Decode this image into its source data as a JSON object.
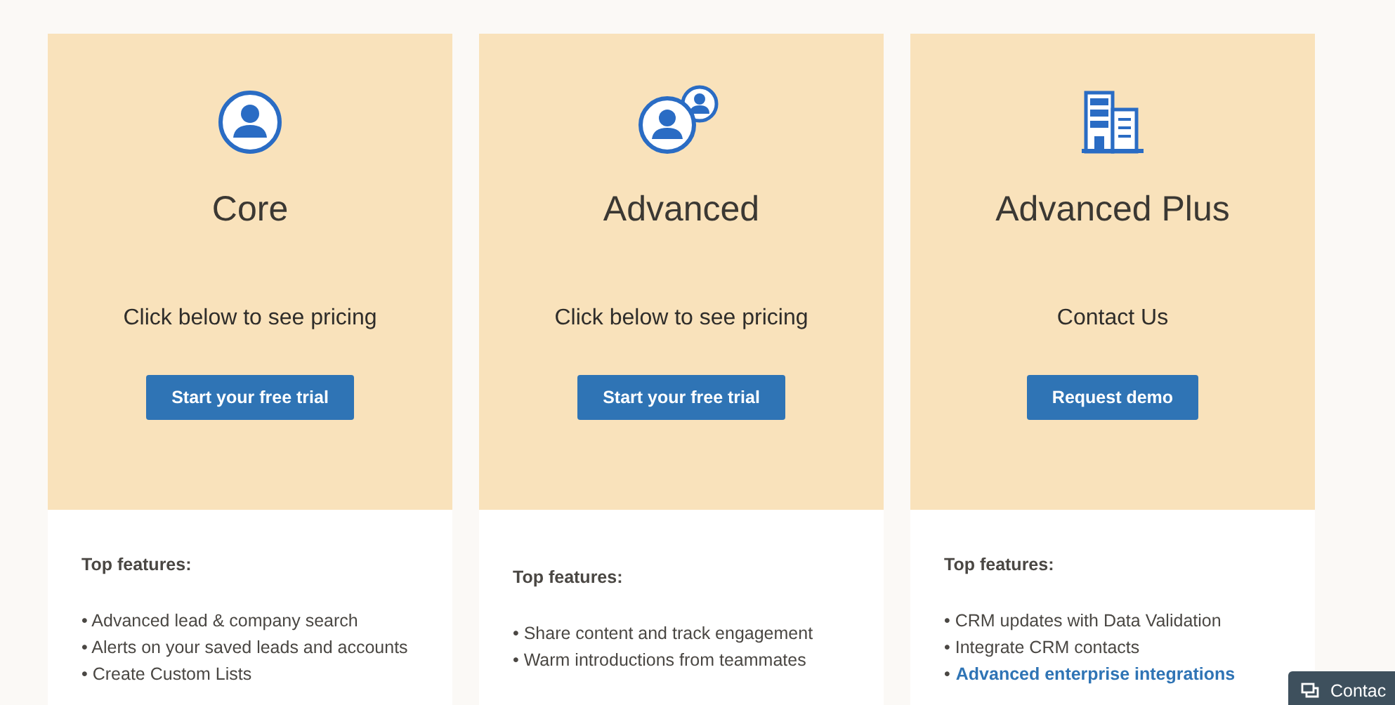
{
  "plans": [
    {
      "kind": "person",
      "name": "Core",
      "description": "Click below to see pricing",
      "button": "Start your free trial",
      "features_heading": "Top features:",
      "features": [
        {
          "kind": "text",
          "text": "• Advanced lead & company search"
        },
        {
          "kind": "text",
          "text": "• Alerts on your saved leads and accounts"
        },
        {
          "kind": "text",
          "text": "• Create Custom Lists"
        }
      ]
    },
    {
      "kind": "people",
      "name": "Advanced",
      "description": "Click below to see pricing",
      "button": "Start your free trial",
      "features_heading": "Top features:",
      "features": [
        {
          "kind": "text",
          "text": "• Share content and track engagement"
        },
        {
          "kind": "text",
          "text": "• Warm introductions from teammates"
        }
      ]
    },
    {
      "kind": "building",
      "name": "Advanced Plus",
      "description": "Contact Us",
      "button": "Request demo",
      "features_heading": "Top features:",
      "features": [
        {
          "kind": "text",
          "text": "• CRM updates with Data Validation"
        },
        {
          "kind": "text",
          "text": "• Integrate CRM contacts"
        },
        {
          "kind": "link",
          "bullet": "•",
          "text": "Advanced enterprise integrations"
        }
      ]
    }
  ],
  "chat_tab": {
    "label": "Contac"
  }
}
